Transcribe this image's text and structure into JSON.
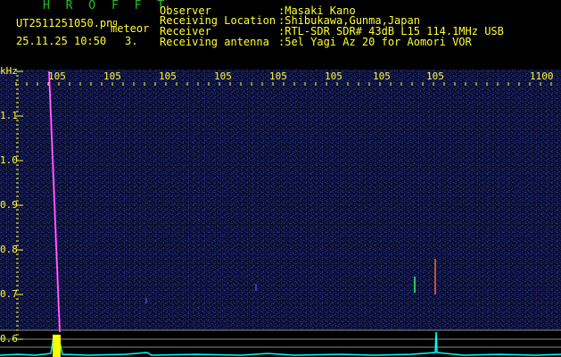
{
  "header": {
    "program": "H R O F F T",
    "filename": "UT2511251050.pn",
    "filename_suffix": "g",
    "category": "meteor",
    "datetime": "25.11.25 10:50",
    "counter": "3.",
    "info_labels": [
      "Observer",
      "Receiving Location",
      "Receiver",
      "Receiving antenna"
    ],
    "info_values": [
      ":Masaki Kano",
      ":Shibukawa,Gunma,Japan",
      ":RTL-SDR SDR# 43dB L15 114.1MHz USB",
      ":5el Yagi Az 20 for Aomori VOR"
    ]
  },
  "axes": {
    "unit": "kHz",
    "time_ticks": [
      "105",
      "105",
      "105",
      "105",
      "105",
      "105",
      "105",
      "105",
      "1100"
    ],
    "freq_ticks": [
      "1.1",
      "1.0",
      "0.9",
      "0.8",
      "0.7",
      "0.6"
    ]
  },
  "colors": {
    "background": "#000000",
    "noise": "#101a4a",
    "text": "#ffff33",
    "title": "#22c222",
    "baseline": "#00ffff",
    "meteor_trail": "#ff33ff"
  }
}
